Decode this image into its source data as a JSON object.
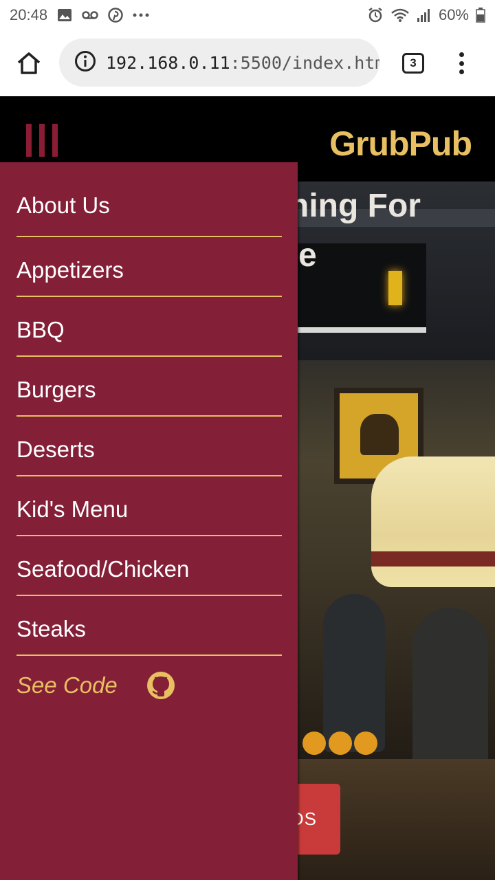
{
  "status_bar": {
    "time": "20:48",
    "battery": "60%",
    "icons": [
      "image-icon",
      "voicemail-icon",
      "pinterest-icon",
      "more-notifications-icon",
      "alarm-icon",
      "wifi-icon",
      "signal-icon",
      "battery-icon"
    ]
  },
  "browser": {
    "url_host": "192.168.0.11",
    "url_rest": ":5500/index.htm",
    "tab_count": "3"
  },
  "header": {
    "brand": "GrubPub"
  },
  "hero": {
    "headline_line1": "hing For",
    "headline_line2": "e",
    "button_fragment": "DS"
  },
  "side_nav": {
    "items": [
      {
        "label": "About Us"
      },
      {
        "label": "Appetizers"
      },
      {
        "label": "BBQ"
      },
      {
        "label": "Burgers"
      },
      {
        "label": "Deserts"
      },
      {
        "label": "Kid's Menu"
      },
      {
        "label": "Seafood/Chicken"
      },
      {
        "label": "Steaks"
      }
    ],
    "see_code": "See Code"
  },
  "colors": {
    "accent_gold": "#e8c061",
    "drawer_burgundy": "#841f38",
    "hero_button_red": "#c93a3a"
  }
}
